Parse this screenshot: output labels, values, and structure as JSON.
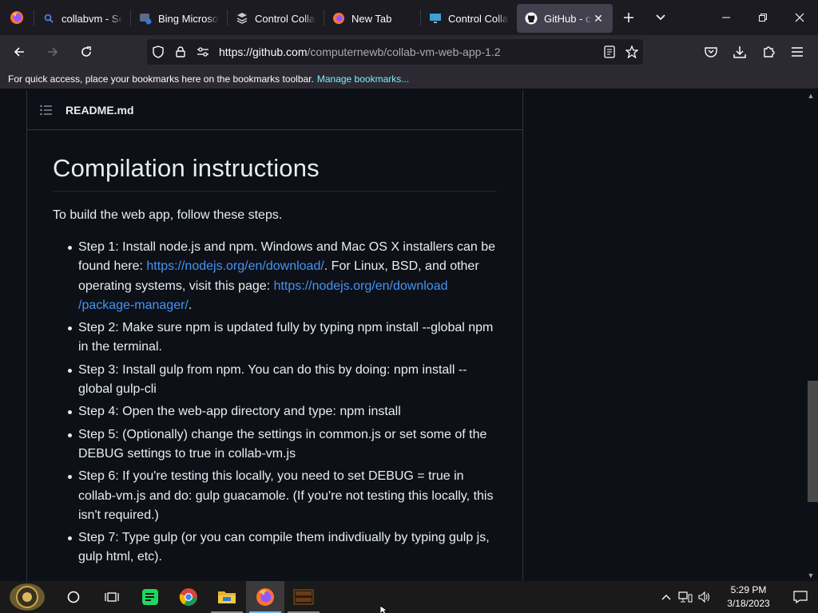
{
  "browser": {
    "tabs": [
      {
        "label": "collabvm - Se",
        "icon": "search-icon",
        "active": false
      },
      {
        "label": "Bing Microsoft",
        "icon": "bing-icon",
        "active": false
      },
      {
        "label": "Control Collab",
        "icon": "collab-icon",
        "active": false
      },
      {
        "label": "New Tab",
        "icon": "firefox-icon",
        "active": false
      },
      {
        "label": "Control Collab",
        "icon": "monitor-icon",
        "active": false
      },
      {
        "label": "GitHub - co",
        "icon": "github-icon",
        "active": true
      }
    ],
    "url_host": "https://github.com",
    "url_path": "/computernewb/collab-vm-web-app-1.2",
    "bookmarks_text": "For quick access, place your bookmarks here on the bookmarks toolbar.",
    "bookmarks_link": "Manage bookmarks..."
  },
  "readme": {
    "filename": "README.md",
    "cut_text": "...                              ...",
    "heading": "Compilation instructions",
    "intro": "To build the web app, follow these steps.",
    "steps": [
      {
        "parts": [
          {
            "t": "Step 1: Install node.js and npm. Windows and Mac OS X installers can be found here: "
          },
          {
            "t": "https://nodejs.org/en/download/",
            "link": true
          },
          {
            "t": ". For Linux, BSD, and other operating systems, visit this page: "
          },
          {
            "t": "https://nodejs.org/en/download /package-manager/",
            "link": true
          },
          {
            "t": "."
          }
        ]
      },
      {
        "parts": [
          {
            "t": "Step 2: Make sure npm is updated fully by typing npm install --global npm in the terminal."
          }
        ]
      },
      {
        "parts": [
          {
            "t": "Step 3: Install gulp from npm. You can do this by doing: npm install --global gulp-cli"
          }
        ]
      },
      {
        "parts": [
          {
            "t": "Step 4: Open the web-app directory and type: npm install"
          }
        ]
      },
      {
        "parts": [
          {
            "t": "Step 5: (Optionally) change the settings in common.js or set some of the DEBUG settings to true in collab-vm.js"
          }
        ]
      },
      {
        "parts": [
          {
            "t": "Step 6: If you're testing this locally, you need to set DEBUG = true in collab-vm.js and do: gulp guacamole. (If you're not testing this locally, this isn't required.)"
          }
        ]
      },
      {
        "parts": [
          {
            "t": "Step 7: Type gulp (or you can compile them indivdiually by typing gulp js, gulp html, etc)."
          }
        ]
      }
    ]
  },
  "taskbar": {
    "time": "5:29 PM",
    "date": "3/18/2023",
    "apps": [
      "start-icon",
      "cortana-icon",
      "task-view-icon",
      "notes-app-icon",
      "chrome-icon",
      "file-explorer-icon",
      "firefox-icon",
      "game-app-icon"
    ]
  },
  "colors": {
    "link": "#4493f8",
    "tab_bg": "#1c1b22",
    "nav_bg": "#2b2a33",
    "page_bg": "#0d1117"
  }
}
